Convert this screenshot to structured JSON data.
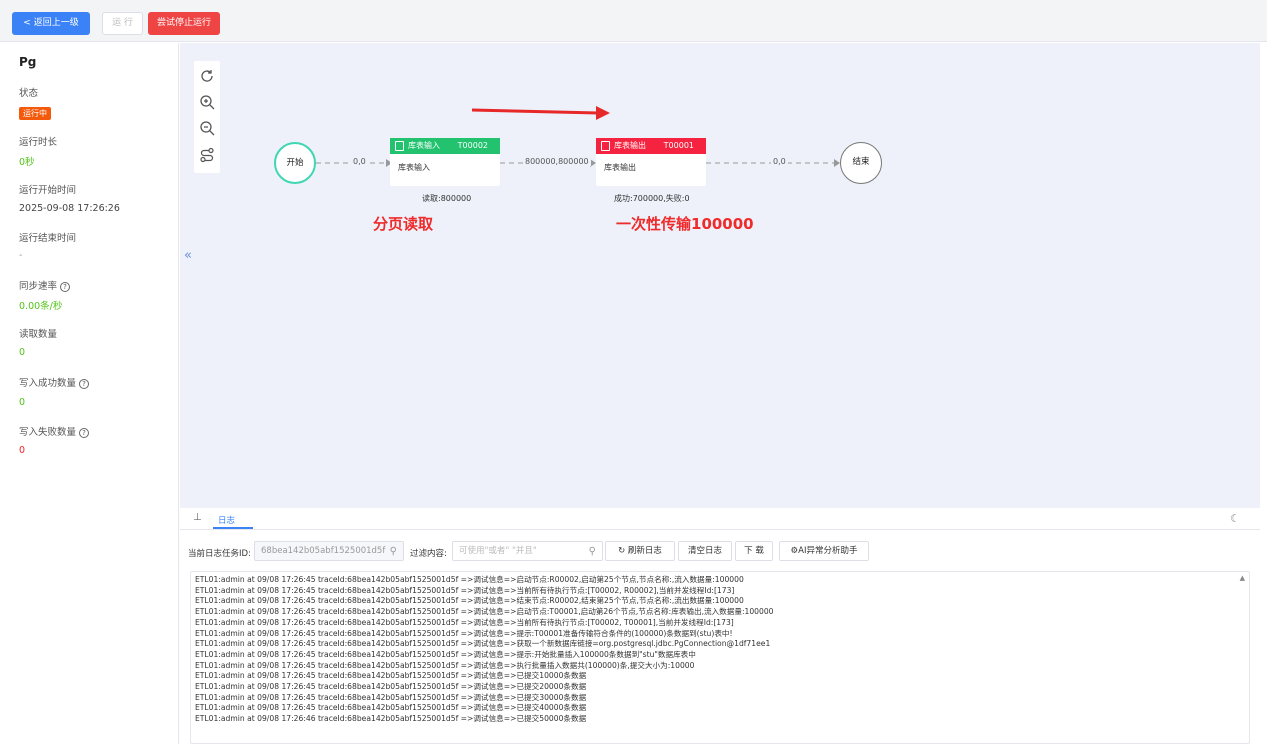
{
  "toolbar": {
    "back_label": "< 返回上一级",
    "run_label": "运 行",
    "stop_label": "尝试停止运行"
  },
  "sidebar": {
    "title": "Pg",
    "status_label": "状态",
    "status_value": "运行中",
    "duration_label": "运行时长",
    "duration_value": "0秒",
    "start_label": "运行开始时间",
    "start_value": "2025-09-08 17:26:26",
    "end_label": "运行结束时间",
    "end_value": "-",
    "rate_label": "同步速率",
    "rate_value": "0.00条/秒",
    "read_label": "读取数量",
    "read_value": "0",
    "success_label": "写入成功数量",
    "success_value": "0",
    "fail_label": "写入失败数量",
    "fail_value": "0"
  },
  "flow": {
    "start_label": "开始",
    "end_label": "结束",
    "edge1_label": "0,0",
    "edge2_label": "800000,800000",
    "edge3_label": "0,0",
    "node1": {
      "title": "库表输入",
      "id": "T00002",
      "body": "库表输入",
      "stat": "读取:800000",
      "color": "#22c26f"
    },
    "node2": {
      "title": "库表输出",
      "id": "T00001",
      "body": "库表输出",
      "stat": "成功:700000,失败:0",
      "color": "#f5233f"
    },
    "annotation1": "分页读取",
    "annotation2": "一次性传输100000",
    "annotation_color": "#ef2b2b"
  },
  "log": {
    "tab_label": "日志",
    "task_id_label": "当前日志任务ID:",
    "task_id_value": "68bea142b05abf1525001d5f",
    "filter_label": "过滤内容:",
    "filter_placeholder": "可使用\"或者\" \"并且\"",
    "refresh_label": "刷新日志",
    "clear_label": "清空日志",
    "download_label": "下 载",
    "ai_label": "AI异常分析助手",
    "lines": [
      "ETL01:admin at 09/08 17:26:45 traceId:68bea142b05abf1525001d5f =>调试信息=>启动节点:R00002,启动第25个节点,节点名称:,流入数据量:100000",
      "ETL01:admin at 09/08 17:26:45 traceId:68bea142b05abf1525001d5f =>调试信息=>当前所有待执行节点:[T00002, R00002],当前并发线程Id:[173]",
      "ETL01:admin at 09/08 17:26:45 traceId:68bea142b05abf1525001d5f =>调试信息=>结束节点:R00002,结束第25个节点,节点名称:,流出数据量:100000",
      "ETL01:admin at 09/08 17:26:45 traceId:68bea142b05abf1525001d5f =>调试信息=>启动节点:T00001,启动第26个节点,节点名称:库表输出,流入数据量:100000",
      "ETL01:admin at 09/08 17:26:45 traceId:68bea142b05abf1525001d5f =>调试信息=>当前所有待执行节点:[T00002, T00001],当前并发线程Id:[173]",
      "ETL01:admin at 09/08 17:26:45 traceId:68bea142b05abf1525001d5f =>调试信息=>提示:T00001准备传输符合条件的(100000)条数据到(stu)表中!",
      "ETL01:admin at 09/08 17:26:45 traceId:68bea142b05abf1525001d5f =>调试信息=>获取一个新数据库链接=org.postgresql.jdbc.PgConnection@1df71ee1",
      "ETL01:admin at 09/08 17:26:45 traceId:68bea142b05abf1525001d5f =>调试信息=>提示:开始批量插入100000条数据到\"stu\"数据库表中",
      "ETL01:admin at 09/08 17:26:45 traceId:68bea142b05abf1525001d5f =>调试信息=>执行批量插入数据共(100000)条,提交大小为:10000",
      "ETL01:admin at 09/08 17:26:45 traceId:68bea142b05abf1525001d5f =>调试信息=>已提交10000条数据",
      "ETL01:admin at 09/08 17:26:45 traceId:68bea142b05abf1525001d5f =>调试信息=>已提交20000条数据",
      "ETL01:admin at 09/08 17:26:45 traceId:68bea142b05abf1525001d5f =>调试信息=>已提交30000条数据",
      "ETL01:admin at 09/08 17:26:45 traceId:68bea142b05abf1525001d5f =>调试信息=>已提交40000条数据",
      "ETL01:admin at 09/08 17:26:46 traceId:68bea142b05abf1525001d5f =>调试信息=>已提交50000条数据"
    ]
  },
  "colors": {
    "primary": "#3b82f6",
    "danger": "#ef4444",
    "status_badge": "#f5590c",
    "success_text": "#52c41a",
    "fail_text": "#f5222d",
    "canvas_bg": "#eef1f9"
  }
}
